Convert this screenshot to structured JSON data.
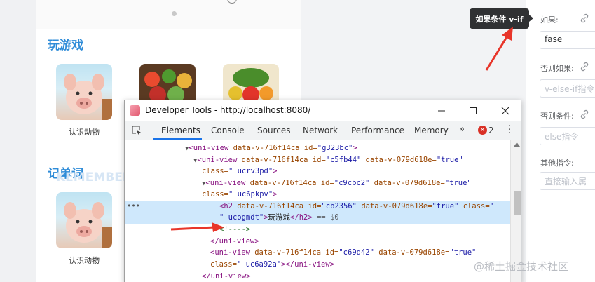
{
  "canvas": {
    "section1_title": "玩游戏",
    "section2_title": "记单词",
    "section2_bg_text": "KEMEMBER",
    "section1_items": [
      {
        "label": "认识动物"
      },
      {
        "label": ""
      },
      {
        "label": ""
      }
    ],
    "section2_items": [
      {
        "label": "认识动物"
      }
    ]
  },
  "tooltip": {
    "text": "如果条件 v-if"
  },
  "right_panel": {
    "if_label": "如果:",
    "if_value": "fase",
    "else_if_label": "否则如果:",
    "else_if_placeholder": "v-else-if指令",
    "else_label": "否则条件:",
    "else_placeholder": "else指令",
    "other_label": "其他指令:",
    "other_placeholder": "直接输入属"
  },
  "devtools": {
    "window_title": "Developer Tools - http://localhost:8080/",
    "tabs": [
      "Elements",
      "Console",
      "Sources",
      "Network",
      "Performance",
      "Memory"
    ],
    "active_tab": "Elements",
    "more_tabs": "»",
    "error_count": "2",
    "error_badge": "✕",
    "code_lines": [
      {
        "pre": "▼",
        "open": "<uni-view",
        "a1": " data-v-716f14ca",
        "a2n": " id=",
        "a2v": "\"g323bc\"",
        "rest": "",
        "close": ">"
      },
      {
        "pre": "▼",
        "open": "<uni-view",
        "a1": " data-v-716f14ca",
        "a2n": " id=",
        "a2v": "\"c5fb44\"",
        "a3n": " data-v-079d618e=",
        "a3v": "\"true\""
      },
      {
        "cont_attr": "class=",
        "cont_val": "\" ucrv3pd\"",
        "close": ">"
      },
      {
        "pre": "▼",
        "open": "<uni-view",
        "a1": " data-v-716f14ca",
        "a2n": " id=",
        "a2v": "\"c9cbc2\"",
        "a3n": " data-v-079d618e=",
        "a3v": "\"true\""
      },
      {
        "cont_attr": "class=",
        "cont_val": "\" uc6pkpv\"",
        "close": ">"
      },
      {
        "open": "<h2",
        "a1": " data-v-716f14ca",
        "a2n": " id=",
        "a2v": "\"cb2356\"",
        "a3n": " data-v-079d618e=",
        "a3v": "\"true\"",
        "a4n": " class=",
        "a4v": "\""
      },
      {
        "cont_val": "\" ucogmdt\"",
        "close": ">",
        "text": "玩游戏",
        "end": "</h2>",
        "eq": " == $0"
      },
      {
        "comment": "<!---->"
      },
      {
        "end": "</uni-view>"
      },
      {
        "open": "<uni-view",
        "a1": " data-v-716f14ca",
        "a2n": " id=",
        "a2v": "\"c69d42\"",
        "a3n": " data-v-079d618e=",
        "a3v": "\"true\""
      },
      {
        "cont_attr": "class=",
        "cont_val": "\" uc6a92a\"",
        "close": ">",
        "end": "</uni-view>"
      },
      {
        "end": "</uni-view>"
      }
    ]
  },
  "watermark": "@稀土掘金技术社区"
}
